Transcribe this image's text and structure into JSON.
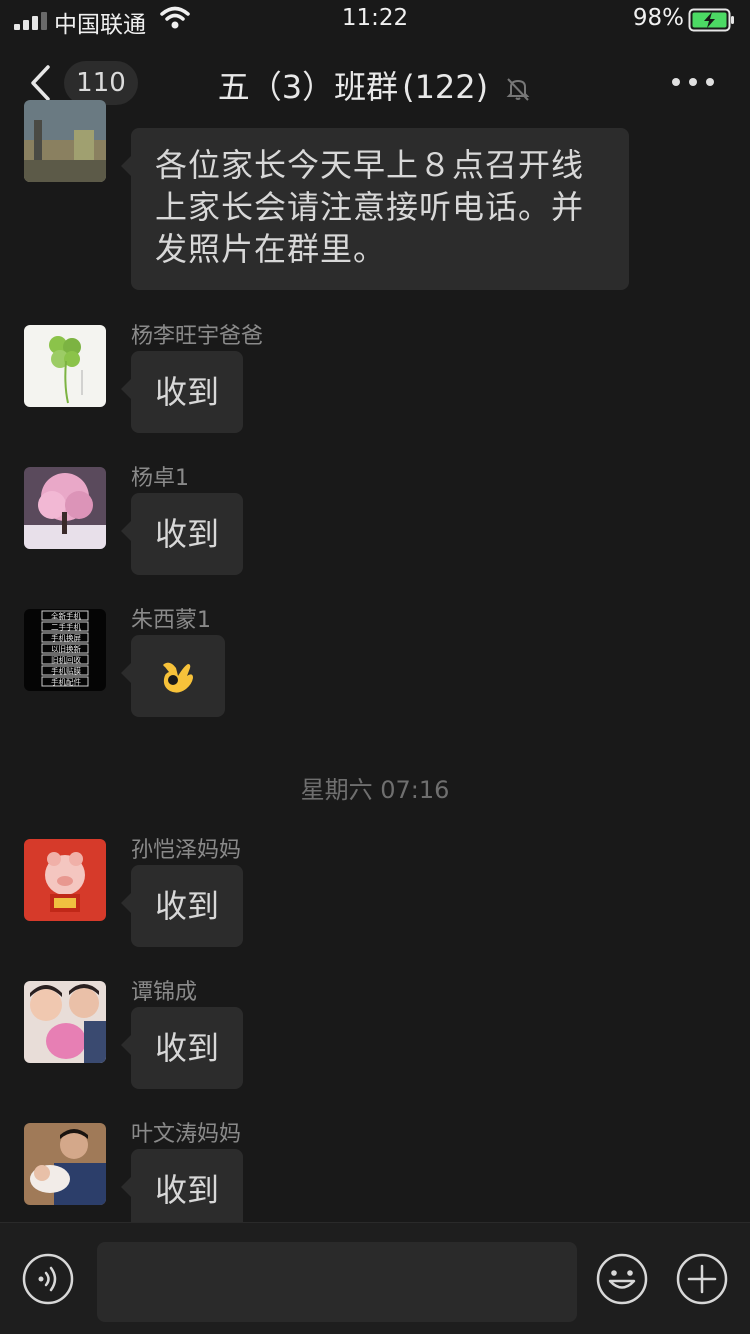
{
  "status_bar": {
    "carrier": "中国联通",
    "time": "11:22",
    "battery": "98%"
  },
  "nav": {
    "unread_count": "110",
    "title": "五（3）班群",
    "member_count": "(122)"
  },
  "messages": [
    {
      "sender": "",
      "text": "各位家长今天早上８点召开线上家长会请注意接听电话。并发照片在群里。"
    },
    {
      "sender": "杨李旺宇爸爸",
      "text": "收到"
    },
    {
      "sender": "杨卓1",
      "text": "收到"
    },
    {
      "sender": "朱西蒙1",
      "text": "👌"
    },
    {
      "sender": "孙恺泽妈妈",
      "text": "收到"
    },
    {
      "sender": "谭锦成",
      "text": "收到"
    },
    {
      "sender": "叶文涛妈妈",
      "text": "收到"
    }
  ],
  "time_divider": "星期六 07:16",
  "avatar_5_lines": [
    "全新手机",
    "二手手机",
    "手机换屏",
    "以旧换新",
    "旧机回收",
    "手机贴膜",
    "手机配件"
  ]
}
